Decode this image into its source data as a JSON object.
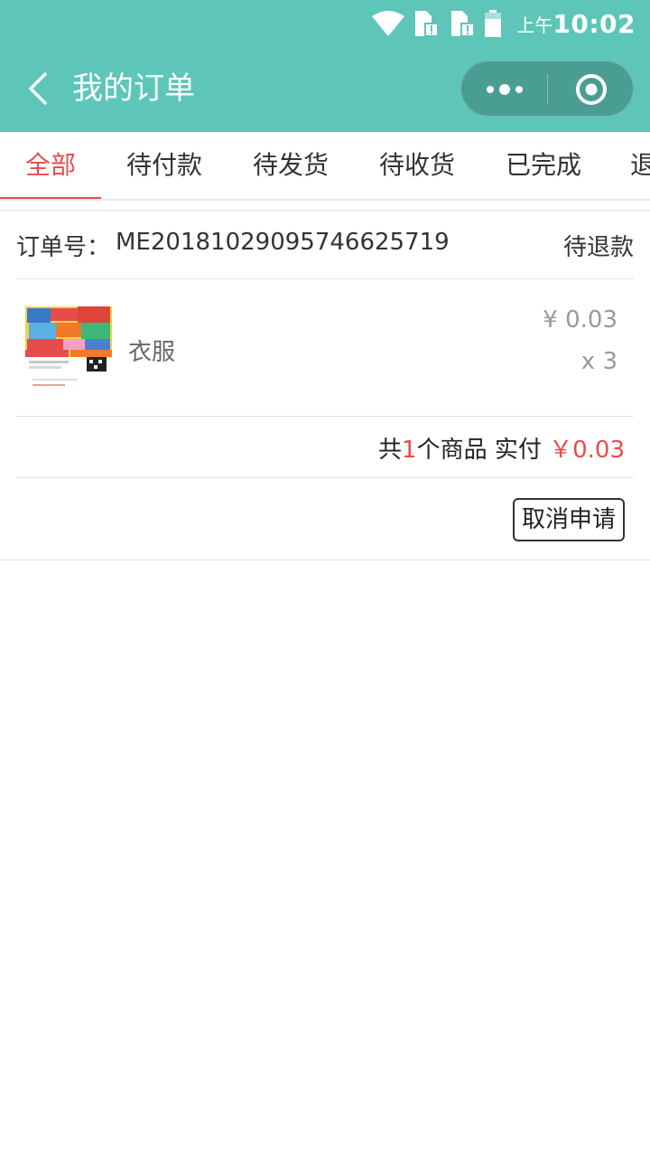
{
  "status_bar": {
    "time_prefix": "上午",
    "time": "10:02",
    "icons": [
      "wifi-icon",
      "sim1-icon",
      "sim2-icon",
      "battery-icon"
    ]
  },
  "nav": {
    "title": "我的订单",
    "back_icon": "chevron-left-icon",
    "more_icon": "more-dots-icon",
    "close_icon": "target-circle-icon",
    "background": "#5dc6b8"
  },
  "tabs": {
    "items": [
      "全部",
      "待付款",
      "待发货",
      "待收货",
      "已完成",
      "退"
    ],
    "active": "全部",
    "active_color": "#e84b4b"
  },
  "order": {
    "order_label": "订单号：",
    "order_number": "ME20181029095746625719",
    "status": "待退款",
    "item": {
      "name": "衣服",
      "price": "¥ 0.03",
      "quantity": "x 3",
      "image_icon": "product-thumbnail-image"
    },
    "summary": {
      "prefix": "共",
      "count": "1",
      "middle": "个商品 实付",
      "total": "￥0.03"
    },
    "action_label": "取消申请"
  }
}
